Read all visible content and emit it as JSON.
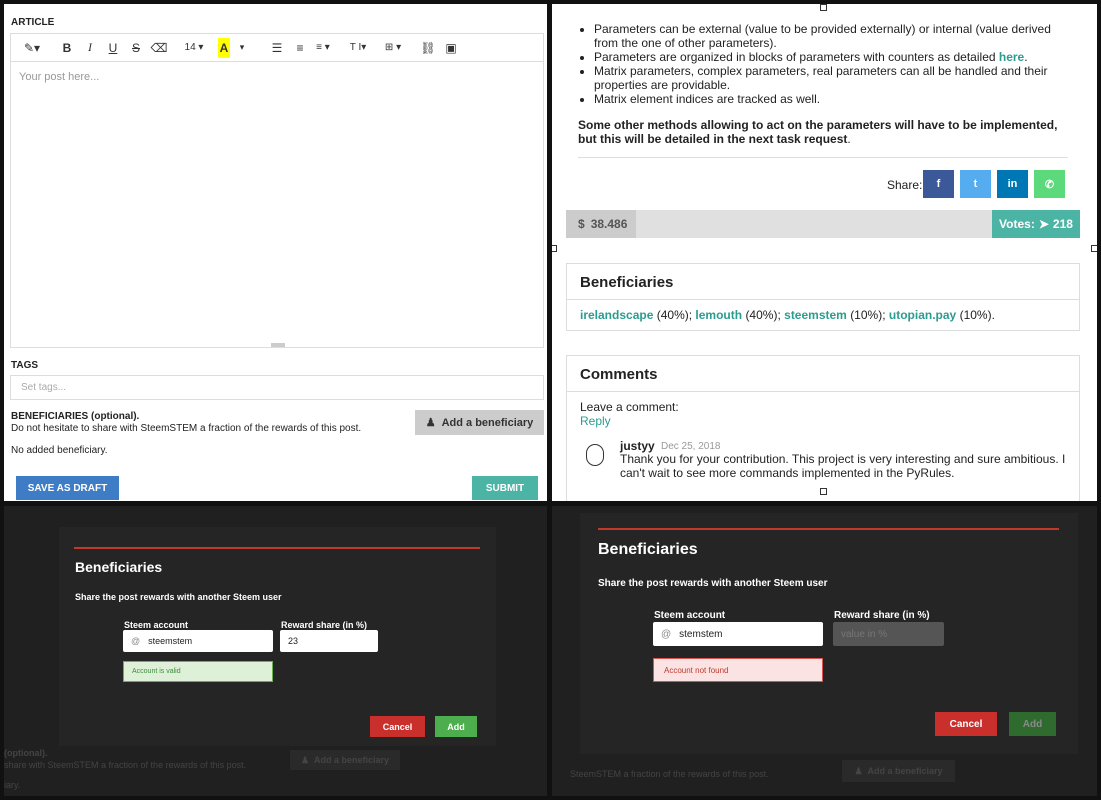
{
  "editor": {
    "article_label": "ARTICLE",
    "toolbar": {
      "magic": "✎▾",
      "bold": "B",
      "italic": "I",
      "underline": "U",
      "strike": "S",
      "eraser": "⌫",
      "font_size": "14 ▾",
      "highlight": "A",
      "highlight_caret": "▾",
      "ul": "☰",
      "ol": "≡",
      "align": "≡ ▾",
      "text_style": "T I▾",
      "table": "⊞ ▾",
      "link": "⛓",
      "image": "▣"
    },
    "placeholder": "Your post here...",
    "tags_label": "TAGS",
    "tags_placeholder": "Set tags...",
    "beneficiaries_title": "BENEFICIARIES (optional).",
    "beneficiaries_desc": "Do not hesitate to share with SteemSTEM a fraction of the rewards of this post.",
    "add_beneficiary": "Add a beneficiary",
    "no_beneficiary": "No added beneficiary.",
    "save_draft": "SAVE AS DRAFT",
    "submit": "SUBMIT"
  },
  "post": {
    "bullets": [
      {
        "text": "Parameters can be external (value to be provided externally) or internal (value derived from the one of other parameters).",
        "link": ""
      },
      {
        "text": "Parameters are organized in blocks of parameters with counters as detailed ",
        "link": "here",
        "after": "."
      },
      {
        "text": "Matrix parameters, complex parameters, real parameters can all be handled and their properties are providable.",
        "link": ""
      },
      {
        "text": "Matrix element indices are tracked as well.",
        "link": ""
      }
    ],
    "bold_paragraph": "Some other methods allowing to act on the parameters will have to be implemented, but this will be detailed in the next task request",
    "bold_paragraph_end": ".",
    "share_label": "Share:",
    "share_buttons": [
      {
        "name": "facebook",
        "glyph": "f",
        "color": "#3b5998"
      },
      {
        "name": "twitter",
        "glyph": "t",
        "color": "#55acee"
      },
      {
        "name": "linkedin",
        "glyph": "in",
        "color": "#0077b5"
      },
      {
        "name": "whatsapp",
        "glyph": "✆",
        "color": "#5cd97a"
      }
    ],
    "payout_currency": "$",
    "payout": "38.486",
    "votes_label": "Votes:",
    "votes_count": "218",
    "beneficiaries_title": "Beneficiaries",
    "beneficiaries": [
      {
        "user": "irelandscape",
        "share": "(40%)",
        "sep": ";"
      },
      {
        "user": "lemouth",
        "share": "(40%)",
        "sep": ";"
      },
      {
        "user": "steemstem",
        "share": "(10%)",
        "sep": ";"
      },
      {
        "user": "utopian.pay",
        "share": "(10%)",
        "sep": "."
      }
    ],
    "comments_title": "Comments",
    "leave_comment": "Leave a comment:",
    "reply": "Reply",
    "comment": {
      "author": "justyy",
      "date": "Dec 25, 2018",
      "text": "Thank you for your contribution. This project is very interesting and sure ambitious. I can't wait to see more commands implemented in the PyRules."
    }
  },
  "modal_valid": {
    "title": "Beneficiaries",
    "subtitle": "Share the post rewards with another Steem user",
    "account_label": "Steem account",
    "account_prefix": "@",
    "account_value": "steemstem",
    "share_label": "Reward share (in %)",
    "share_value": "23",
    "status": "Account is valid",
    "cancel": "Cancel",
    "add": "Add",
    "bg_title": "(optional).",
    "bg_desc": "share with SteemSTEM a fraction of the rewards of this post.",
    "bg_button": "Add a beneficiary",
    "bg_extra": "iary."
  },
  "modal_invalid": {
    "title": "Beneficiaries",
    "subtitle": "Share the post rewards with another Steem user",
    "account_label": "Steem account",
    "account_prefix": "@",
    "account_value": "stemstem",
    "share_label": "Reward share (in %)",
    "share_placeholder": "value in %",
    "status": "Account not found",
    "cancel": "Cancel",
    "add": "Add",
    "bg_desc": "SteemSTEM a fraction of the rewards of this post.",
    "bg_button": "Add a beneficiary"
  }
}
